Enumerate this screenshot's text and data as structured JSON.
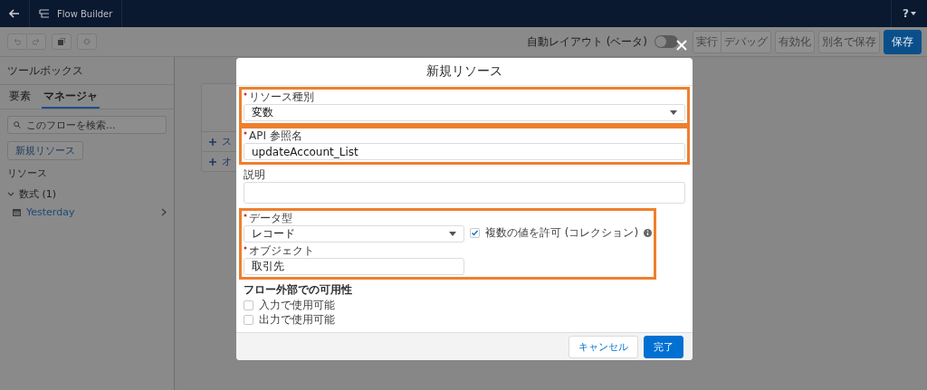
{
  "app_header": {
    "title": "Flow Builder",
    "help": "?"
  },
  "toolbar": {
    "auto_layout": {
      "label": "自動レイアウト (ベータ)",
      "on": false
    },
    "button_groups": [
      [
        {
          "label": "実行",
          "disabled": true
        },
        {
          "label": "デバッグ",
          "disabled": true
        }
      ],
      [
        {
          "label": "有効化",
          "disabled": true
        }
      ],
      [
        {
          "label": "別名で保存",
          "disabled": true
        }
      ],
      [
        {
          "label": "保存",
          "disabled": false
        }
      ]
    ]
  },
  "sidebar": {
    "title": "ツールボックス",
    "tabs": [
      {
        "label": "要素",
        "selected": false
      },
      {
        "label": "マネージャ",
        "selected": true
      }
    ],
    "search": {
      "placeholder": "このフローを検索..."
    },
    "new_button": "新規リソース",
    "section": "リソース",
    "groups": [
      {
        "label": "数式 (1)",
        "expanded": true,
        "items": [
          {
            "label": "Yesterday"
          }
        ]
      }
    ]
  },
  "canvas": {
    "card_items": [
      "ス",
      "オ"
    ]
  },
  "modal": {
    "title": "新規リソース",
    "groups": [
      {
        "highlighted": true,
        "fields": [
          {
            "kind": "select",
            "label": "リソース種別",
            "required": true,
            "value": "変数"
          }
        ]
      },
      {
        "highlighted": true,
        "fields": [
          {
            "kind": "text",
            "label": "API 参照名",
            "required": true,
            "value": "updateAccount_List"
          }
        ]
      },
      {
        "highlighted": false,
        "fields": [
          {
            "kind": "textarea",
            "label": "説明",
            "required": false
          }
        ]
      },
      {
        "highlighted": true,
        "fields": [
          {
            "kind": "select",
            "label": "データ型",
            "required": true,
            "value": "レコード"
          },
          {
            "kind": "text",
            "label": "オブジェクト",
            "required": true,
            "value": "取引先"
          }
        ],
        "aside": {
          "label": "複数の値を許可 (コレクション)",
          "checked": true
        }
      },
      {
        "highlighted": false,
        "heading": "フロー外部での可用性",
        "fields": [
          {
            "kind": "checkbox",
            "label": "入力で使用可能",
            "checked": false
          },
          {
            "kind": "checkbox",
            "label": "出力で使用可能",
            "checked": false
          }
        ]
      }
    ],
    "buttons": [
      {
        "label": "キャンセル",
        "kind": "cancel"
      },
      {
        "label": "完了",
        "kind": "done"
      }
    ]
  }
}
